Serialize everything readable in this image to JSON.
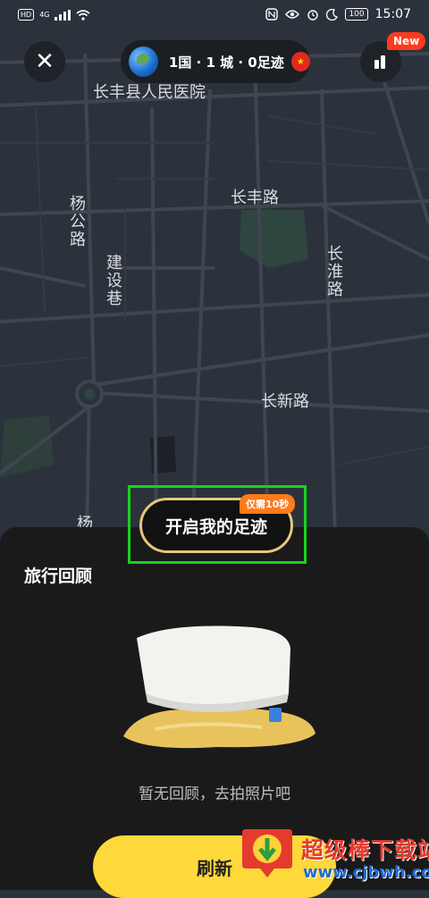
{
  "status_bar": {
    "network_badge": "HD",
    "signal": "4G",
    "battery": "100",
    "time": "15:07"
  },
  "top_bar": {
    "close_label": "✕",
    "summary": "1国 · 1 城 · 0足迹",
    "new_badge": "New"
  },
  "map": {
    "labels": {
      "hospital": "长丰县人民医院",
      "changfeng_road": "长丰路",
      "yanggong_road": "杨公路",
      "jianshe_lane": "建设巷",
      "changhuai_road": "长淮路",
      "changxin_road": "长新路",
      "partial": "杨"
    }
  },
  "cta": {
    "label": "开启我的足迹",
    "badge": "仅需10秒"
  },
  "sheet": {
    "title": "旅行回顾",
    "empty_text": "暂无回顾，去拍照片吧",
    "refresh_label": "刷新"
  },
  "watermark": {
    "title": "超级棒下载站",
    "url": "www.cjbwh.com"
  },
  "colors": {
    "map_bg": "#2c323b",
    "road": "#3f4650",
    "highlight_border": "#18d21f",
    "cta_border": "#e6c77b",
    "refresh_button": "#ffd83a",
    "badge_red": "#ff3b1f"
  }
}
